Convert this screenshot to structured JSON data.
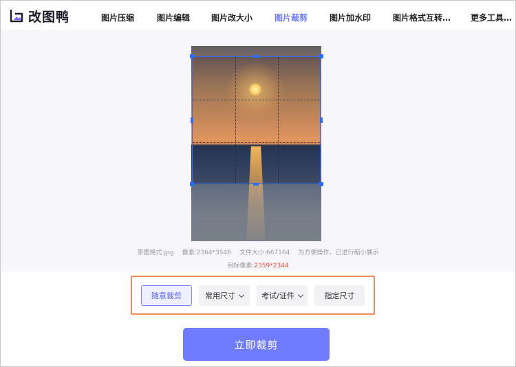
{
  "header": {
    "logo_text": "改图鸭",
    "nav": [
      {
        "label": "图片压缩"
      },
      {
        "label": "图片编辑"
      },
      {
        "label": "图片改大小"
      },
      {
        "label": "图片裁剪",
        "active": true
      },
      {
        "label": "图片加水印"
      },
      {
        "label": "图片格式互转…"
      },
      {
        "label": "更多工具…"
      }
    ]
  },
  "info": {
    "format_label": "原图格式:",
    "format_value": "jpg",
    "pixels_label": "像素:",
    "pixels_value": "2364*3546",
    "filesize_label": "文件大小:",
    "filesize_value": "667164",
    "note": "为方便操作，已进行缩小展示",
    "target_label": "目标像素:",
    "target_value": "2359*2344"
  },
  "toolbar": {
    "free_crop": "随意裁剪",
    "common_size": "常用尺寸",
    "exam_id": "考试/证件",
    "custom_size": "指定尺寸"
  },
  "cta_label": "立即裁剪",
  "colors": {
    "accent": "#6f7cff",
    "crop_border": "#2d6cff",
    "highlight_outline": "#f28b5b",
    "target_pixels": "#f04b3a"
  }
}
